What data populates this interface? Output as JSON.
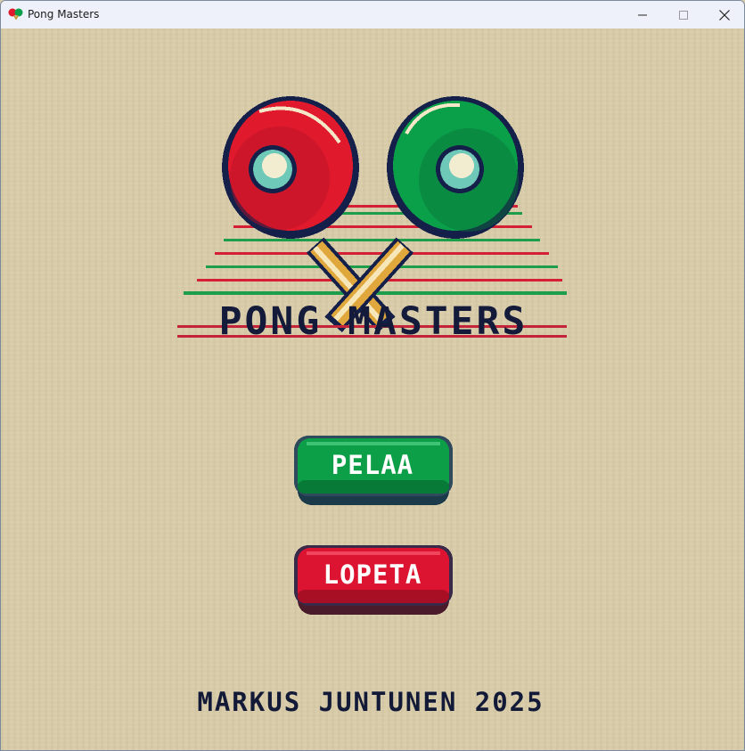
{
  "window": {
    "title": "Pong Masters",
    "icon": "ping-pong-paddles-icon",
    "controls": {
      "minimize_icon": "minimize-icon",
      "maximize_icon": "maximize-icon",
      "close_icon": "close-icon"
    }
  },
  "menu": {
    "game_title": "PONG MASTERS",
    "play_label": "PELAA",
    "quit_label": "LOPETA",
    "credits": "MARKUS JUNTUNEN 2025"
  },
  "colors": {
    "background": "#d8cba8",
    "play_button": "#0c9f48",
    "quit_button": "#dc1431",
    "title_text": "#141b3a",
    "left_paddle": "#e0192d",
    "right_paddle": "#0aa04a"
  }
}
